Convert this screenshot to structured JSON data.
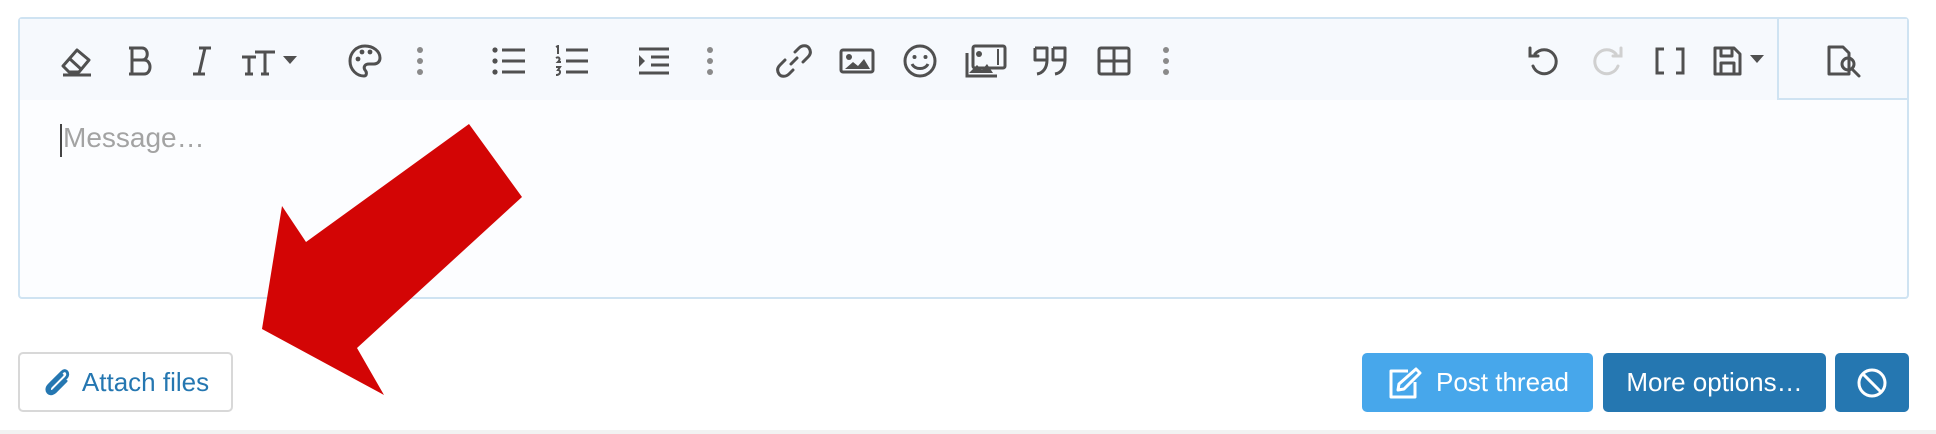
{
  "editor": {
    "placeholder": "Message…"
  },
  "toolbar": {
    "icons": [
      "clear-formatting-icon",
      "bold-icon",
      "italic-icon",
      "font-size-icon",
      "text-color-icon",
      "more-text-options-icon",
      "bulleted-list-icon",
      "numbered-list-icon",
      "indent-icon",
      "more-paragraph-options-icon",
      "insert-link-icon",
      "insert-image-icon",
      "insert-emoji-icon",
      "insert-media-icon",
      "insert-quote-icon",
      "insert-table-icon",
      "more-insert-options-icon",
      "undo-icon",
      "redo-icon",
      "toggle-bbcode-icon",
      "drafts-icon",
      "preview-icon"
    ]
  },
  "actions": {
    "attach_files": "Attach files",
    "post_thread": "Post thread",
    "more_options": "More options…"
  },
  "colors": {
    "link_blue": "#2577b1",
    "primary_light_blue": "#47a7eb",
    "primary_dark_blue": "#2577b1",
    "icon_gray": "#505050",
    "disabled_icon": "#d0d0d0",
    "arrow_red": "#d30505",
    "editor_border": "#cfe3f2"
  }
}
